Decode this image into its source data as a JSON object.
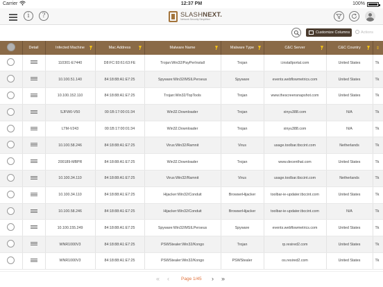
{
  "status_bar": {
    "carrier": "Carrier",
    "time": "12:37 PM",
    "battery": "100%"
  },
  "header": {
    "logo_name_light": "SLASH",
    "logo_name_bold": "NEXT.",
    "logo_tagline": "Network Security Simplified",
    "info_glyph": "i",
    "help_glyph": "?"
  },
  "toolbar": {
    "customize_label": "Customize Columns",
    "actions_label": "Actions"
  },
  "table": {
    "columns": [
      "Detail",
      "Infected Machine",
      "Mac Address",
      "Malware Name",
      "Malware Type",
      "C&C Server",
      "C&C Country"
    ],
    "rows": [
      [
        "110301-E7440",
        "D8:FC:93:61:63:FE",
        "Trojan:Win32/PayPerInstall",
        "Trojan",
        "i.installportal.com",
        "United States"
      ],
      [
        "10.100.51.140",
        "84:18:88:A1:E7:25",
        "Spyware:Win32/MSILPerseus",
        "Spyware",
        "events.webflowmetrics.com",
        "United States"
      ],
      [
        "10.100.152.110",
        "84:18:88:A1:E7:25",
        "Trojan:Win32/TopTools",
        "Trojan",
        "www.thescreensnapshot.com",
        "United States"
      ],
      [
        "SJFW0-V50",
        "00:1B:17:00:01:34",
        "Win32.Downloader",
        "Trojan",
        "xinyu388.com",
        "N/A"
      ],
      [
        "LTM-V243",
        "00:1B:17:00:01:34",
        "Win32.Downloader",
        "Trojan",
        "xinyu388.com",
        "N/A"
      ],
      [
        "10.100.58.246",
        "84:18:88:A1:E7:25",
        "Virus:Win32/Ramnit",
        "Virus",
        "usage.toolbar.tbccint.com",
        "Netherlands"
      ],
      [
        "200189-MBPR",
        "84:18:88:A1:E7:25",
        "Win32.Downloader",
        "Trojan",
        "www.decenthat.com",
        "United States"
      ],
      [
        "10.100.34.110",
        "84:18:88:A1:E7:25",
        "Virus:Win32/Ramnit",
        "Virus",
        "usage.toolbar.tbccint.com",
        "Netherlands"
      ],
      [
        "10.100.34.110",
        "84:18:88:A1:E7:25",
        "Hijacker:Win32/Conduit",
        "BrowserHijacker",
        "toolbar-ie-updater.tbccint.com",
        "United States"
      ],
      [
        "10.100.58.246",
        "84:18:88:A1:E7:25",
        "Hijacker:Win32/Conduit",
        "BrowserHijacker",
        "toolbar-ie-updater.tbccint.com",
        "N/A"
      ],
      [
        "10.100.155.249",
        "84:18:88:A1:E7:25",
        "Spyware:Win32/MSILPerseus",
        "Spyware",
        "events.webflowmetrics.com",
        "United States"
      ],
      [
        "WNR1000V3",
        "84:18:88:A1:E7:25",
        "PSWStealer:Win32/Kongo",
        "Trojan",
        "rp.resired2.com",
        "United States"
      ],
      [
        "WNR1000V3",
        "84:18:88:A1:E7:25",
        "PSWStealer:Win32/Kongo",
        "PSWStealer",
        "os.resired2.com",
        "United States"
      ]
    ],
    "trailing_column_stub": [
      "Tk",
      "Tk",
      "Tk",
      "Tk",
      "Tk",
      "Tk",
      "Tk",
      "Tk",
      "Tk",
      "Tk",
      "Tk",
      "Tk",
      "Tk"
    ]
  },
  "pagination": {
    "page_label": "Page 1/45"
  },
  "colors": {
    "header_bg": "#8a6a47",
    "filter_icon": "#f3c218",
    "page_label": "#e0703a",
    "customize_bg": "#4a3b2e"
  },
  "icons": [
    "menu-icon",
    "info-icon",
    "help-icon",
    "filter-icon",
    "refresh-icon",
    "user-icon",
    "search-icon",
    "columns-icon",
    "actions-icon",
    "detail-list-icon",
    "sort-icon"
  ]
}
